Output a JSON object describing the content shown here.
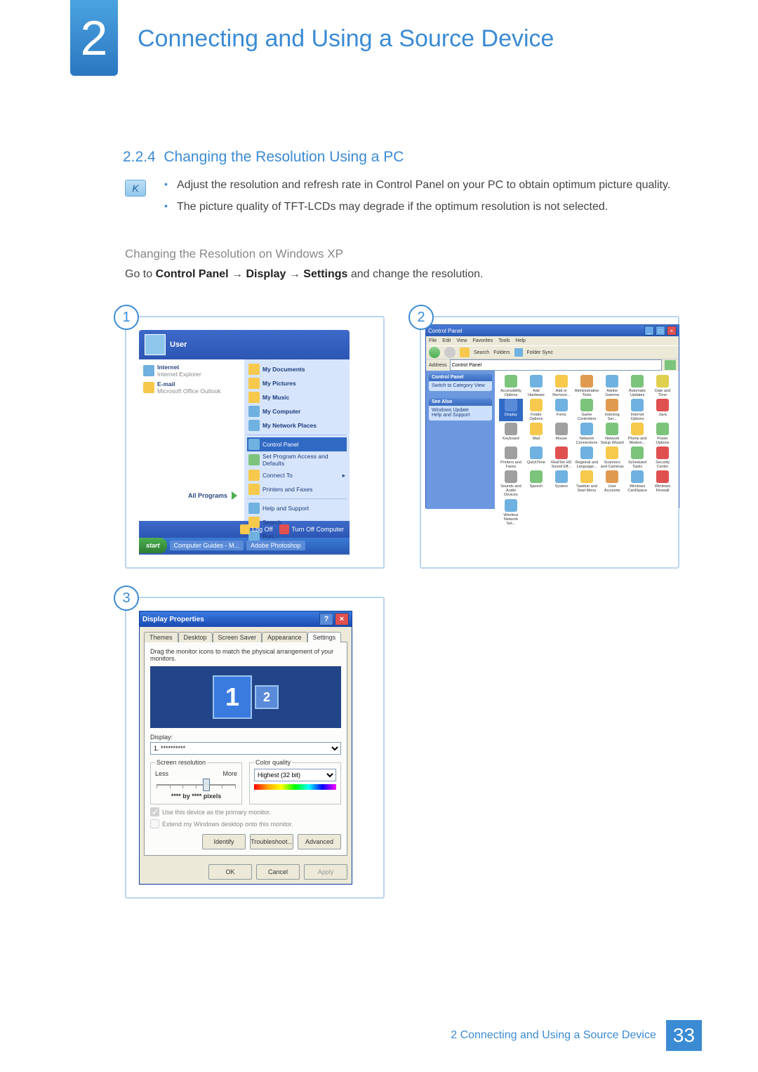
{
  "chapter": {
    "number": "2",
    "title": "Connecting and Using a Source Device"
  },
  "section": {
    "number": "2.2.4",
    "title": "Changing the Resolution Using a PC"
  },
  "notes": {
    "item1": "Adjust the resolution and refresh rate in Control Panel on your PC to obtain optimum picture quality.",
    "item2": "The picture quality of TFT-LCDs may degrade if the optimum resolution is not selected."
  },
  "subheading": "Changing the Resolution on Windows XP",
  "instruction": {
    "prefix": "Go to ",
    "b1": "Control Panel",
    "arrow": " → ",
    "b2": "Display",
    "b3": "Settings",
    "suffix": " and change the resolution."
  },
  "steps": {
    "s1": "1",
    "s2": "2",
    "s3": "3"
  },
  "startMenu": {
    "user": "User",
    "left": {
      "internet": "Internet",
      "internetSub": "Internet Explorer",
      "email": "E-mail",
      "emailSub": "Microsoft Office Outlook",
      "allPrograms": "All Programs"
    },
    "right": {
      "myDocuments": "My Documents",
      "myPictures": "My Pictures",
      "myMusic": "My Music",
      "myComputer": "My Computer",
      "myNetwork": "My Network Places",
      "controlPanel": "Control Panel",
      "setProgram": "Set Program Access and Defaults",
      "connectTo": "Connect To",
      "printers": "Printers and Faxes",
      "help": "Help and Support",
      "search": "Search",
      "run": "Run..."
    },
    "logOff": "Log Off",
    "turnOff": "Turn Off Computer",
    "taskbar": {
      "start": "start",
      "task1": "Computer Guides - M...",
      "task2": "Adobe Photoshop"
    }
  },
  "controlPanel": {
    "title": "Control Panel",
    "menu": {
      "file": "File",
      "edit": "Edit",
      "view": "View",
      "favorites": "Favorites",
      "tools": "Tools",
      "help": "Help"
    },
    "toolbar": {
      "search": "Search",
      "folders": "Folders",
      "folderSync": "Folder Sync"
    },
    "addressLabel": "Address",
    "addressValue": "Control Panel",
    "sidebar": {
      "box1Title": "Control Panel",
      "box1Item": "Switch to Category View",
      "box2Title": "See Also",
      "box2Item1": "Windows Update",
      "box2Item2": "Help and Support"
    },
    "items": [
      "Accessibility Options",
      "Add Hardware",
      "Add or Remove...",
      "Administrative Tools",
      "Adobe Gamma",
      "Automatic Updates",
      "Date and Time",
      "Display",
      "Folder Options",
      "Fonts",
      "Game Controllers",
      "Indexing Ser...",
      "Internet Options",
      "Java",
      "Keyboard",
      "Mail",
      "Mouse",
      "Network Connections",
      "Network Setup Wizard",
      "Phone and Modem...",
      "Power Options",
      "Printers and Faxes",
      "QuickTime",
      "RealTek HD Sound Eff...",
      "Regional and Language...",
      "Scanners and Cameras",
      "Scheduled Tasks",
      "Security Center",
      "Sounds and Audio Devices",
      "Speech",
      "System",
      "Taskbar and Start Menu",
      "User Accounts",
      "Windows CardSpace",
      "Windows Firewall",
      "Wireless Network Set..."
    ],
    "selectedIndex": 7
  },
  "displayProps": {
    "title": "Display Properties",
    "tabs": {
      "themes": "Themes",
      "desktop": "Desktop",
      "screensaver": "Screen Saver",
      "appearance": "Appearance",
      "settings": "Settings"
    },
    "hint": "Drag the monitor icons to match the physical arrangement of your monitors.",
    "mon1": "1",
    "mon2": "2",
    "displayLabel": "Display:",
    "displayValue": "1. **********",
    "screenRes": {
      "legend": "Screen resolution",
      "less": "Less",
      "more": "More",
      "current": "**** by **** pixels"
    },
    "colorQual": {
      "legend": "Color quality",
      "value": "Highest (32 bit)"
    },
    "chk1": "Use this device as the primary monitor.",
    "chk2": "Extend my Windows desktop onto this monitor.",
    "btnIdentify": "Identify",
    "btnTroubleshoot": "Troubleshoot...",
    "btnAdvanced": "Advanced",
    "btnOK": "OK",
    "btnCancel": "Cancel",
    "btnApply": "Apply"
  },
  "footer": {
    "chapter": "2",
    "title": "Connecting and Using a Source Device",
    "page": "33"
  },
  "cpIconColors": [
    "#7cc47c",
    "#6fb1e0",
    "#f6c84c",
    "#e09a50",
    "#6fb1e0",
    "#7cc47c",
    "#e0d050",
    "#5a8bd8",
    "#f6c84c",
    "#6fb1e0",
    "#7cc47c",
    "#e09a50",
    "#6fb1e0",
    "#e05050",
    "#a0a0a0",
    "#f6c84c",
    "#a0a0a0",
    "#6fb1e0",
    "#7cc47c",
    "#f6c84c",
    "#7cc47c",
    "#a0a0a0",
    "#6fb1e0",
    "#e05050",
    "#6fb1e0",
    "#f6c84c",
    "#7cc47c",
    "#e05050",
    "#a0a0a0",
    "#7cc47c",
    "#6fb1e0",
    "#f6c84c",
    "#e09a50",
    "#6fb1e0",
    "#e05050",
    "#6fb1e0"
  ]
}
